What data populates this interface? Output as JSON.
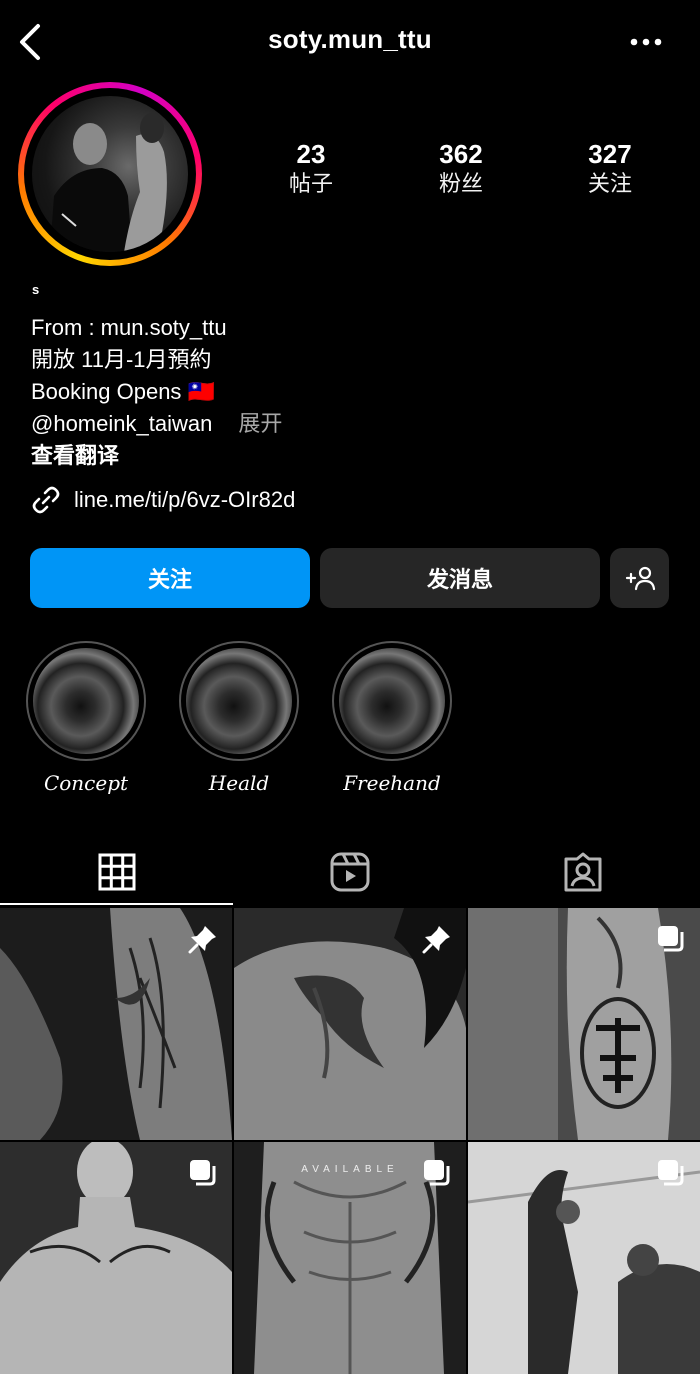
{
  "header": {
    "username": "soty.mun_ttu"
  },
  "stats": [
    {
      "value": "23",
      "label": "帖子"
    },
    {
      "value": "362",
      "label": "粉丝"
    },
    {
      "value": "327",
      "label": "关注"
    }
  ],
  "bio": {
    "name": "s",
    "lines": [
      "From : mun.soty_ttu",
      "開放 11月-1月預約",
      "Booking Opens 🇹🇼"
    ],
    "mention": "@homeink_taiwan",
    "more": "展开",
    "translate": "查看翻译",
    "link": "line.me/ti/p/6vz-OIr82d"
  },
  "buttons": {
    "follow": "关注",
    "message": "发消息"
  },
  "highlights": [
    {
      "label": "Concept"
    },
    {
      "label": "Heald"
    },
    {
      "label": "Freehand"
    }
  ],
  "tabs": [
    {
      "name": "grid",
      "active": true
    },
    {
      "name": "reels",
      "active": false
    },
    {
      "name": "tagged",
      "active": false
    }
  ],
  "grid": {
    "posts": [
      {
        "badge": "pin"
      },
      {
        "badge": "pin"
      },
      {
        "badge": "carousel"
      },
      {
        "badge": "carousel"
      },
      {
        "badge": "carousel",
        "overlay_text": "AVAILABLE"
      },
      {
        "badge": "carousel"
      }
    ]
  },
  "colors": {
    "accent": "#0095f6",
    "secondary_button": "#262626",
    "muted_text": "#a8a8a8"
  }
}
